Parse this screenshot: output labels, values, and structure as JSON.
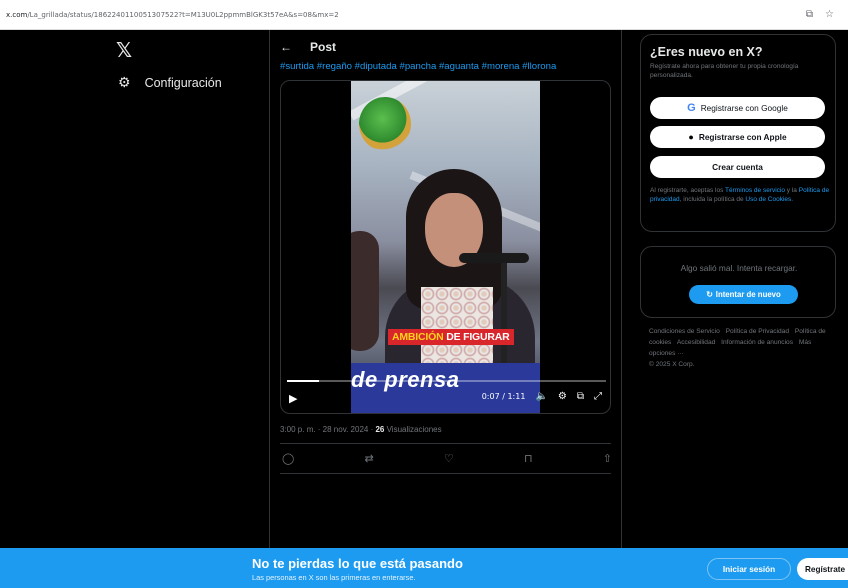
{
  "browser": {
    "url_domain": "x.com",
    "url_path": "/La_grillada/status/1862240110051307522?t=M13U0L2ppmmBlGK3t57eA&s=08&mx=2",
    "icons": [
      "share-icon",
      "star-icon"
    ]
  },
  "nav": {
    "logo": "𝕏",
    "settings_label": "Configuración"
  },
  "post": {
    "back": "←",
    "title": "Post",
    "hashtags": "#surtida #regaño #diputada #pancha #aguanta #morena #llorona",
    "video": {
      "overlay_left": "AMBICIÓN",
      "overlay_right": "DE FIGURAR",
      "caption": "de prensa",
      "time": "0:07 / 1:11",
      "progress": 0.1
    },
    "meta_time": "3:00 p. m. · 28 nov. 2024 · ",
    "views_count": "26",
    "views_label": " Visualizaciones"
  },
  "sidebar": {
    "signup": {
      "title": "¿Eres nuevo en X?",
      "subtitle": "Regístrate ahora para obtener tu propia cronología personalizada.",
      "google": "Registrarse con Google",
      "apple": "Registrarse con Apple",
      "create": "Crear cuenta",
      "terms_pre": "Al registrarte, aceptas los ",
      "terms_link1": "Términos de servicio",
      "terms_mid": " y la ",
      "terms_link2": "Política de privacidad",
      "terms_mid2": ", incluida la política de ",
      "terms_link3": "Uso de Cookies",
      "terms_end": "."
    },
    "error": {
      "message": "Algo salió mal. Intenta recargar.",
      "retry": "Intentar de nuevo"
    },
    "footer": [
      "Condiciones de Servicio",
      "Política de Privacidad",
      "Política de cookies",
      "Accesibilidad",
      "Información de anuncios",
      "Más opciones ···",
      "© 2025 X Corp."
    ]
  },
  "banner": {
    "title": "No te pierdas lo que está pasando",
    "subtitle": "Las personas en X son las primeras en enterarse.",
    "login": "Iniciar sesión",
    "register": "Regístrate"
  },
  "colors": {
    "accent": "#1d9bf0",
    "background": "#000000",
    "border": "#2f3336",
    "muted": "#71767b"
  }
}
